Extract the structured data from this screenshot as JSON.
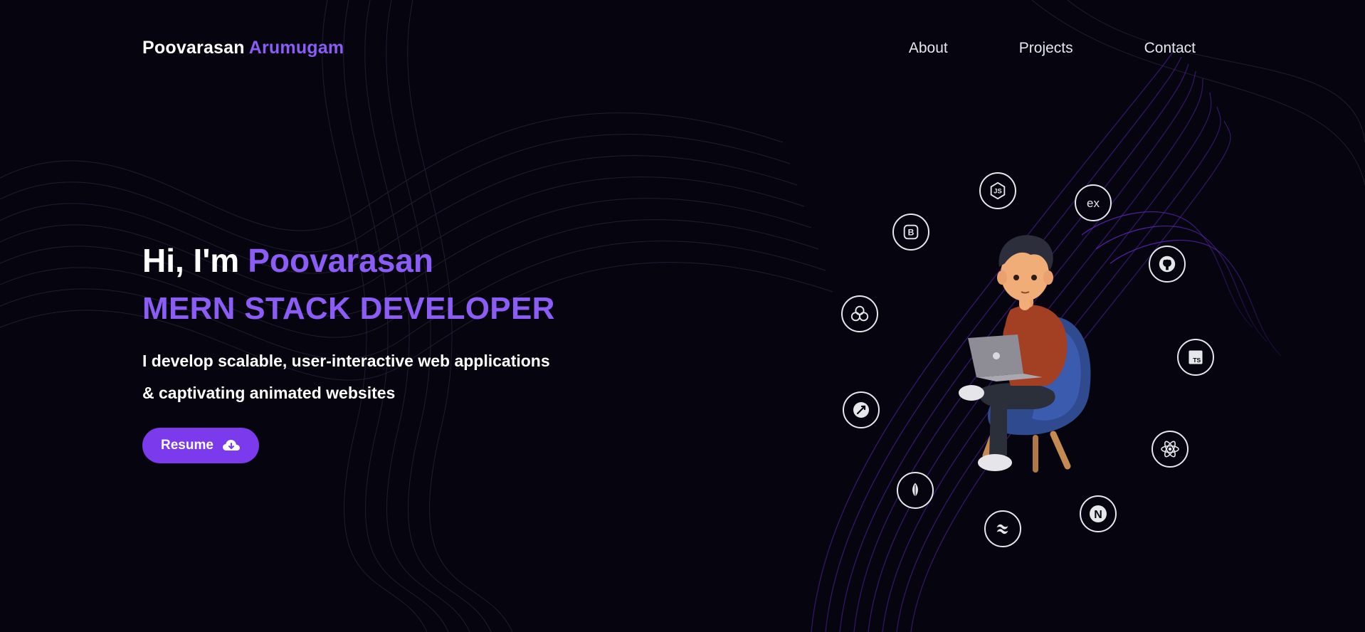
{
  "header": {
    "first_name": "Poovarasan",
    "last_name": "Arumugam",
    "nav": [
      {
        "label": "About"
      },
      {
        "label": "Projects"
      },
      {
        "label": "Contact"
      }
    ]
  },
  "hero": {
    "greeting": "Hi, I'm",
    "name": "Poovarasan",
    "role": "MERN STACK DEVELOPER",
    "tagline_line1": "I develop scalable, user-interactive web applications",
    "tagline_line2": "& captivating animated websites",
    "resume_label": "Resume"
  },
  "tech_icons": [
    {
      "name": "nodejs-icon",
      "glyph": "JS"
    },
    {
      "name": "express-icon",
      "glyph": "ex"
    },
    {
      "name": "bootstrap-icon",
      "glyph": "B"
    },
    {
      "name": "github-icon"
    },
    {
      "name": "redux-icon"
    },
    {
      "name": "typescript-icon",
      "glyph": "TS"
    },
    {
      "name": "postman-icon"
    },
    {
      "name": "react-icon"
    },
    {
      "name": "mongodb-icon"
    },
    {
      "name": "nextjs-icon",
      "glyph": "N"
    },
    {
      "name": "tailwind-icon"
    }
  ],
  "colors": {
    "background": "#06050f",
    "accent": "#8b5cf6",
    "button": "#7c3aed",
    "text": "#ffffff"
  }
}
